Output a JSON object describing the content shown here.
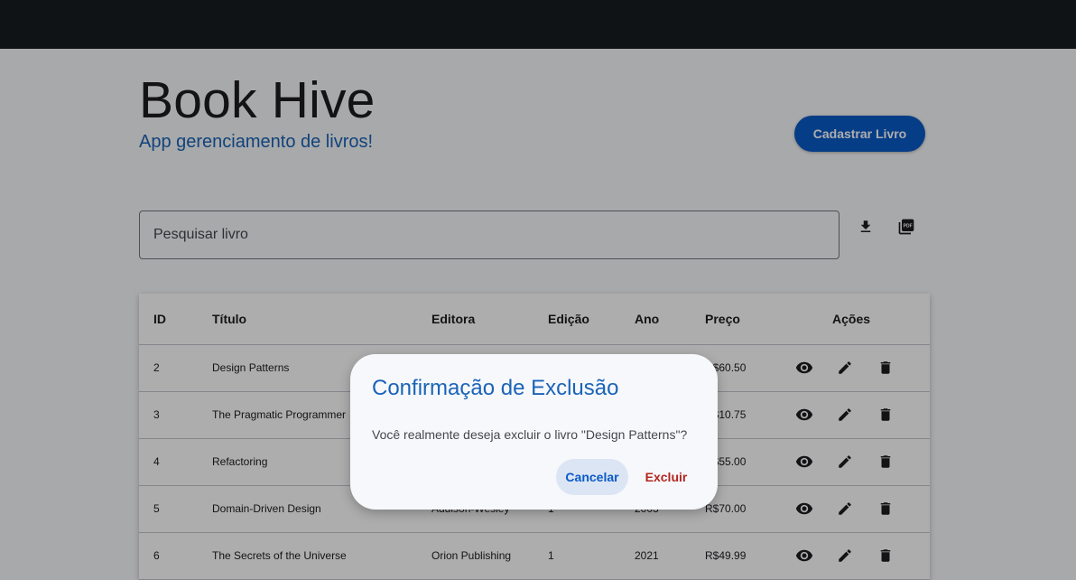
{
  "app": {
    "title": "Book Hive",
    "subtitle": "App gerenciamento de livros!",
    "add_button_label": "Cadastrar Livro"
  },
  "search": {
    "placeholder": "Pesquisar livro",
    "value": ""
  },
  "toolbar_icons": [
    "download-icon",
    "pdf-icon"
  ],
  "table": {
    "headers": {
      "id": "ID",
      "title": "Título",
      "publisher": "Editora",
      "edition": "Edição",
      "year": "Ano",
      "price": "Preço",
      "actions": "Ações"
    },
    "rows": [
      {
        "id": "2",
        "title": "Design Patterns",
        "publisher": "",
        "edition": "",
        "year": "",
        "price": "R$60.50"
      },
      {
        "id": "3",
        "title": "The Pragmatic Programmer",
        "publisher": "",
        "edition": "",
        "year": "",
        "price": "R$10.75"
      },
      {
        "id": "4",
        "title": "Refactoring",
        "publisher": "",
        "edition": "",
        "year": "",
        "price": "R$55.00"
      },
      {
        "id": "5",
        "title": "Domain-Driven Design",
        "publisher": "Addison-Wesley",
        "edition": "1",
        "year": "2003",
        "price": "R$70.00"
      },
      {
        "id": "6",
        "title": "The Secrets of the Universe",
        "publisher": "Orion Publishing",
        "edition": "1",
        "year": "2021",
        "price": "R$49.99"
      }
    ],
    "row_action_icons": [
      "eye-icon",
      "pencil-icon",
      "trash-icon"
    ]
  },
  "dialog": {
    "title": "Confirmação de Exclusão",
    "message": "Você realmente deseja excluir o livro \"Design Patterns\"?",
    "cancel_label": "Cancelar",
    "confirm_label": "Excluir"
  },
  "colors": {
    "topbar": "#191c20",
    "primary": "#0a5ac8",
    "accent_text": "#1a64b8",
    "danger": "#b3261e"
  }
}
